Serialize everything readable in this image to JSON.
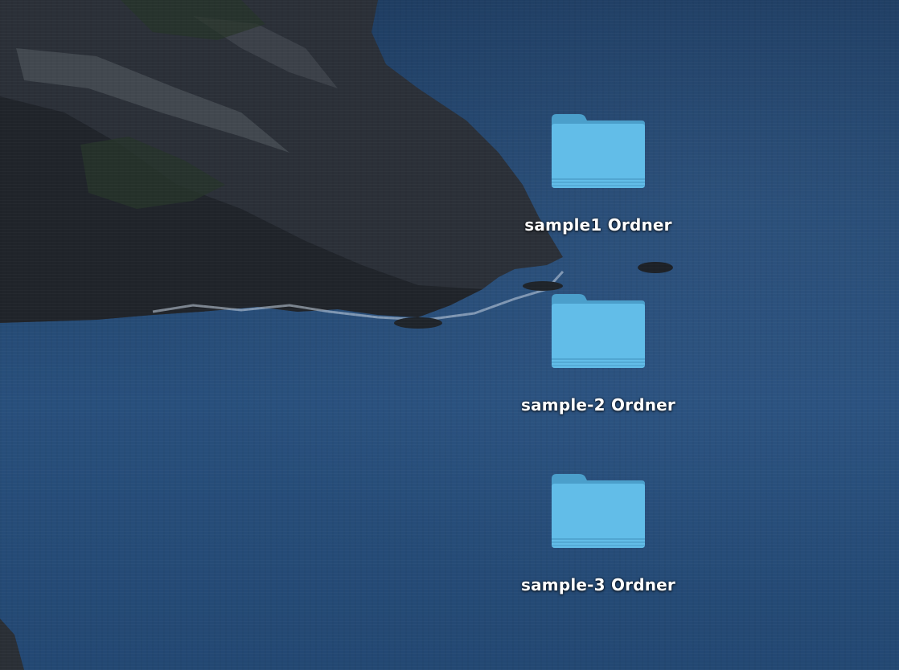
{
  "desktop": {
    "icons": [
      {
        "label": "sample1 Ordner",
        "icon": "folder-icon"
      },
      {
        "label": "sample-2 Ordner",
        "icon": "folder-icon"
      },
      {
        "label": "sample-3 Ordner",
        "icon": "folder-icon"
      }
    ]
  },
  "colors": {
    "folder_front": "#5cb8e6",
    "folder_back": "#4a9cc8",
    "water": "#244a76",
    "rock": "#2a2f36"
  }
}
